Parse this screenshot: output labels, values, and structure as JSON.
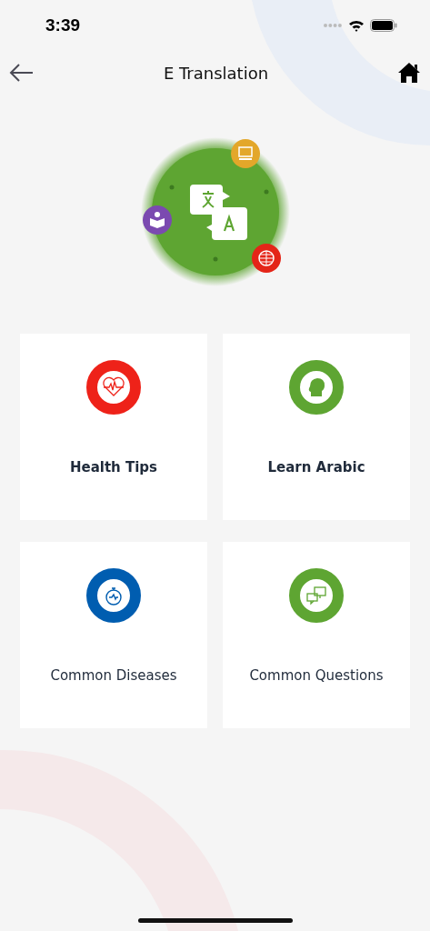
{
  "status_bar": {
    "time": "3:39"
  },
  "header": {
    "title": "E Translation"
  },
  "cards": [
    {
      "label": "Health Tips",
      "kind": "heart",
      "color": "#ee2219",
      "bold": true
    },
    {
      "label": "Learn Arabic",
      "kind": "head",
      "color": "#5ea532",
      "bold": true
    },
    {
      "label": "Common Diseases",
      "kind": "stopwatch",
      "color": "#005db0",
      "bold": false
    },
    {
      "label": "Common Questions",
      "kind": "chat",
      "color": "#5ea532",
      "bold": false
    }
  ]
}
